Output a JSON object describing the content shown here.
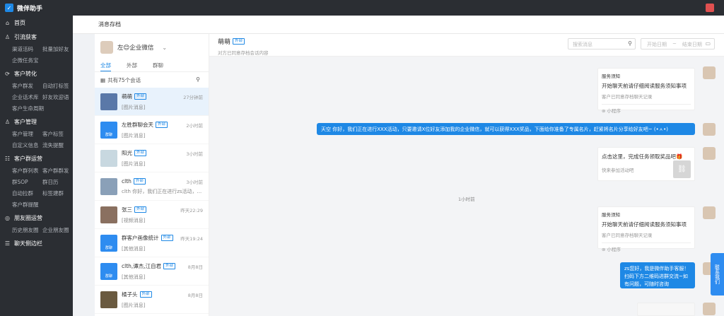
{
  "app": {
    "title": "微伴助手"
  },
  "sidebar": {
    "home": "首页",
    "sections": [
      {
        "title": "引流获客",
        "icon": "user-icon",
        "items": [
          "渠道活码",
          "批量加好友",
          "企微任务宝"
        ]
      },
      {
        "title": "客户转化",
        "icon": "transfer-icon",
        "items": [
          "客户群发",
          "自动打标签",
          "企业话术库",
          "好友欢迎语",
          "客户生命周期"
        ]
      },
      {
        "title": "客户管理",
        "icon": "user-icon",
        "items": [
          "客户管理",
          "客户标签",
          "自定义信息",
          "流失提醒"
        ]
      },
      {
        "title": "客户群运营",
        "icon": "group-icon",
        "items": [
          "客户群列表",
          "客户群群发",
          "群SOP",
          "群日历",
          "自动拉群",
          "标签建群",
          "客户群提醒"
        ]
      },
      {
        "title": "朋友圈运营",
        "icon": "moments-icon",
        "items": [
          "历史朋友圈",
          "企业朋友圈"
        ]
      },
      {
        "title": "聊天侧边栏",
        "icon": "sidebar-icon",
        "items": []
      }
    ]
  },
  "header": {
    "title": "消息存档"
  },
  "account": {
    "name": "左😊企业微信"
  },
  "tabs": [
    "全部",
    "外部",
    "群聊"
  ],
  "list": {
    "total": "共有75个会话"
  },
  "conversations": [
    {
      "name": "萌萌",
      "tag": "外部",
      "msg": "[图片消息]",
      "time": "27分钟前",
      "color": "#5a78a8"
    },
    {
      "name": "左胜群聊会天",
      "tag": "外部",
      "msg": "[图片消息]",
      "time": "2小时前",
      "color": "#2e8cf0",
      "label": "群聊"
    },
    {
      "name": "阳光",
      "tag": "外部",
      "msg": "[图片消息]",
      "time": "3小时前",
      "color": "#c8d8e0"
    },
    {
      "name": "clth",
      "tag": "外部",
      "msg": "clth 你好，我们正在进行zs活动，...",
      "time": "3小时前",
      "color": "#8aa0b8"
    },
    {
      "name": "张三",
      "tag": "外部",
      "msg": "[视频消息]",
      "time": "昨天22:29",
      "color": "#8a7060"
    },
    {
      "name": "群客户画像统计",
      "tag": "外部",
      "msg": "[其他消息]",
      "time": "昨天19:24",
      "color": "#2e8cf0",
      "label": "群聊"
    },
    {
      "name": "clth,谭杰,江自君",
      "tag": "外部",
      "msg": "[其他消息]",
      "time": "8月8日",
      "color": "#2e8cf0",
      "label": "群聊"
    },
    {
      "name": "橘子头",
      "tag": "外部",
      "msg": "[图片消息]",
      "time": "8月8日",
      "color": "#6a5a40"
    }
  ],
  "chat": {
    "name": "萌萌",
    "tag": "外部",
    "subtitle": "对方已同意存档会话内容",
    "search_placeholder": "搜索消息",
    "start_date": "开始日期",
    "end_date": "结束日期",
    "cards": [
      {
        "source": "服务须知",
        "title": "开始聊天前请仔细阅读服务须知事项",
        "desc": "客户已同意存档聊天记录",
        "footer": "小程序"
      },
      {
        "source": "服务须知",
        "title": "开始聊天前请仔细阅读服务须知事项",
        "desc": "客户已同意存档聊天记录",
        "footer": "小程序"
      }
    ],
    "bubble1": "天空 你好，我们正在进行XXX活动，只要邀请X位好友添加我的企业微信，就可以获得XXX奖品，下面给你准备了专属名片，赶紧将名片分享给好友吧~ (•ㅅ•)",
    "link_card": {
      "title": "点击这里，完成任务领取奖品吧🎁",
      "desc": "快来参加活动吧"
    },
    "time_sep": "1小时前",
    "bubble2": "zs您好，我是微伴助手客服！扫码下方二维码进群交流~如有问题，可随时咨询"
  },
  "float_button": "联系我们"
}
